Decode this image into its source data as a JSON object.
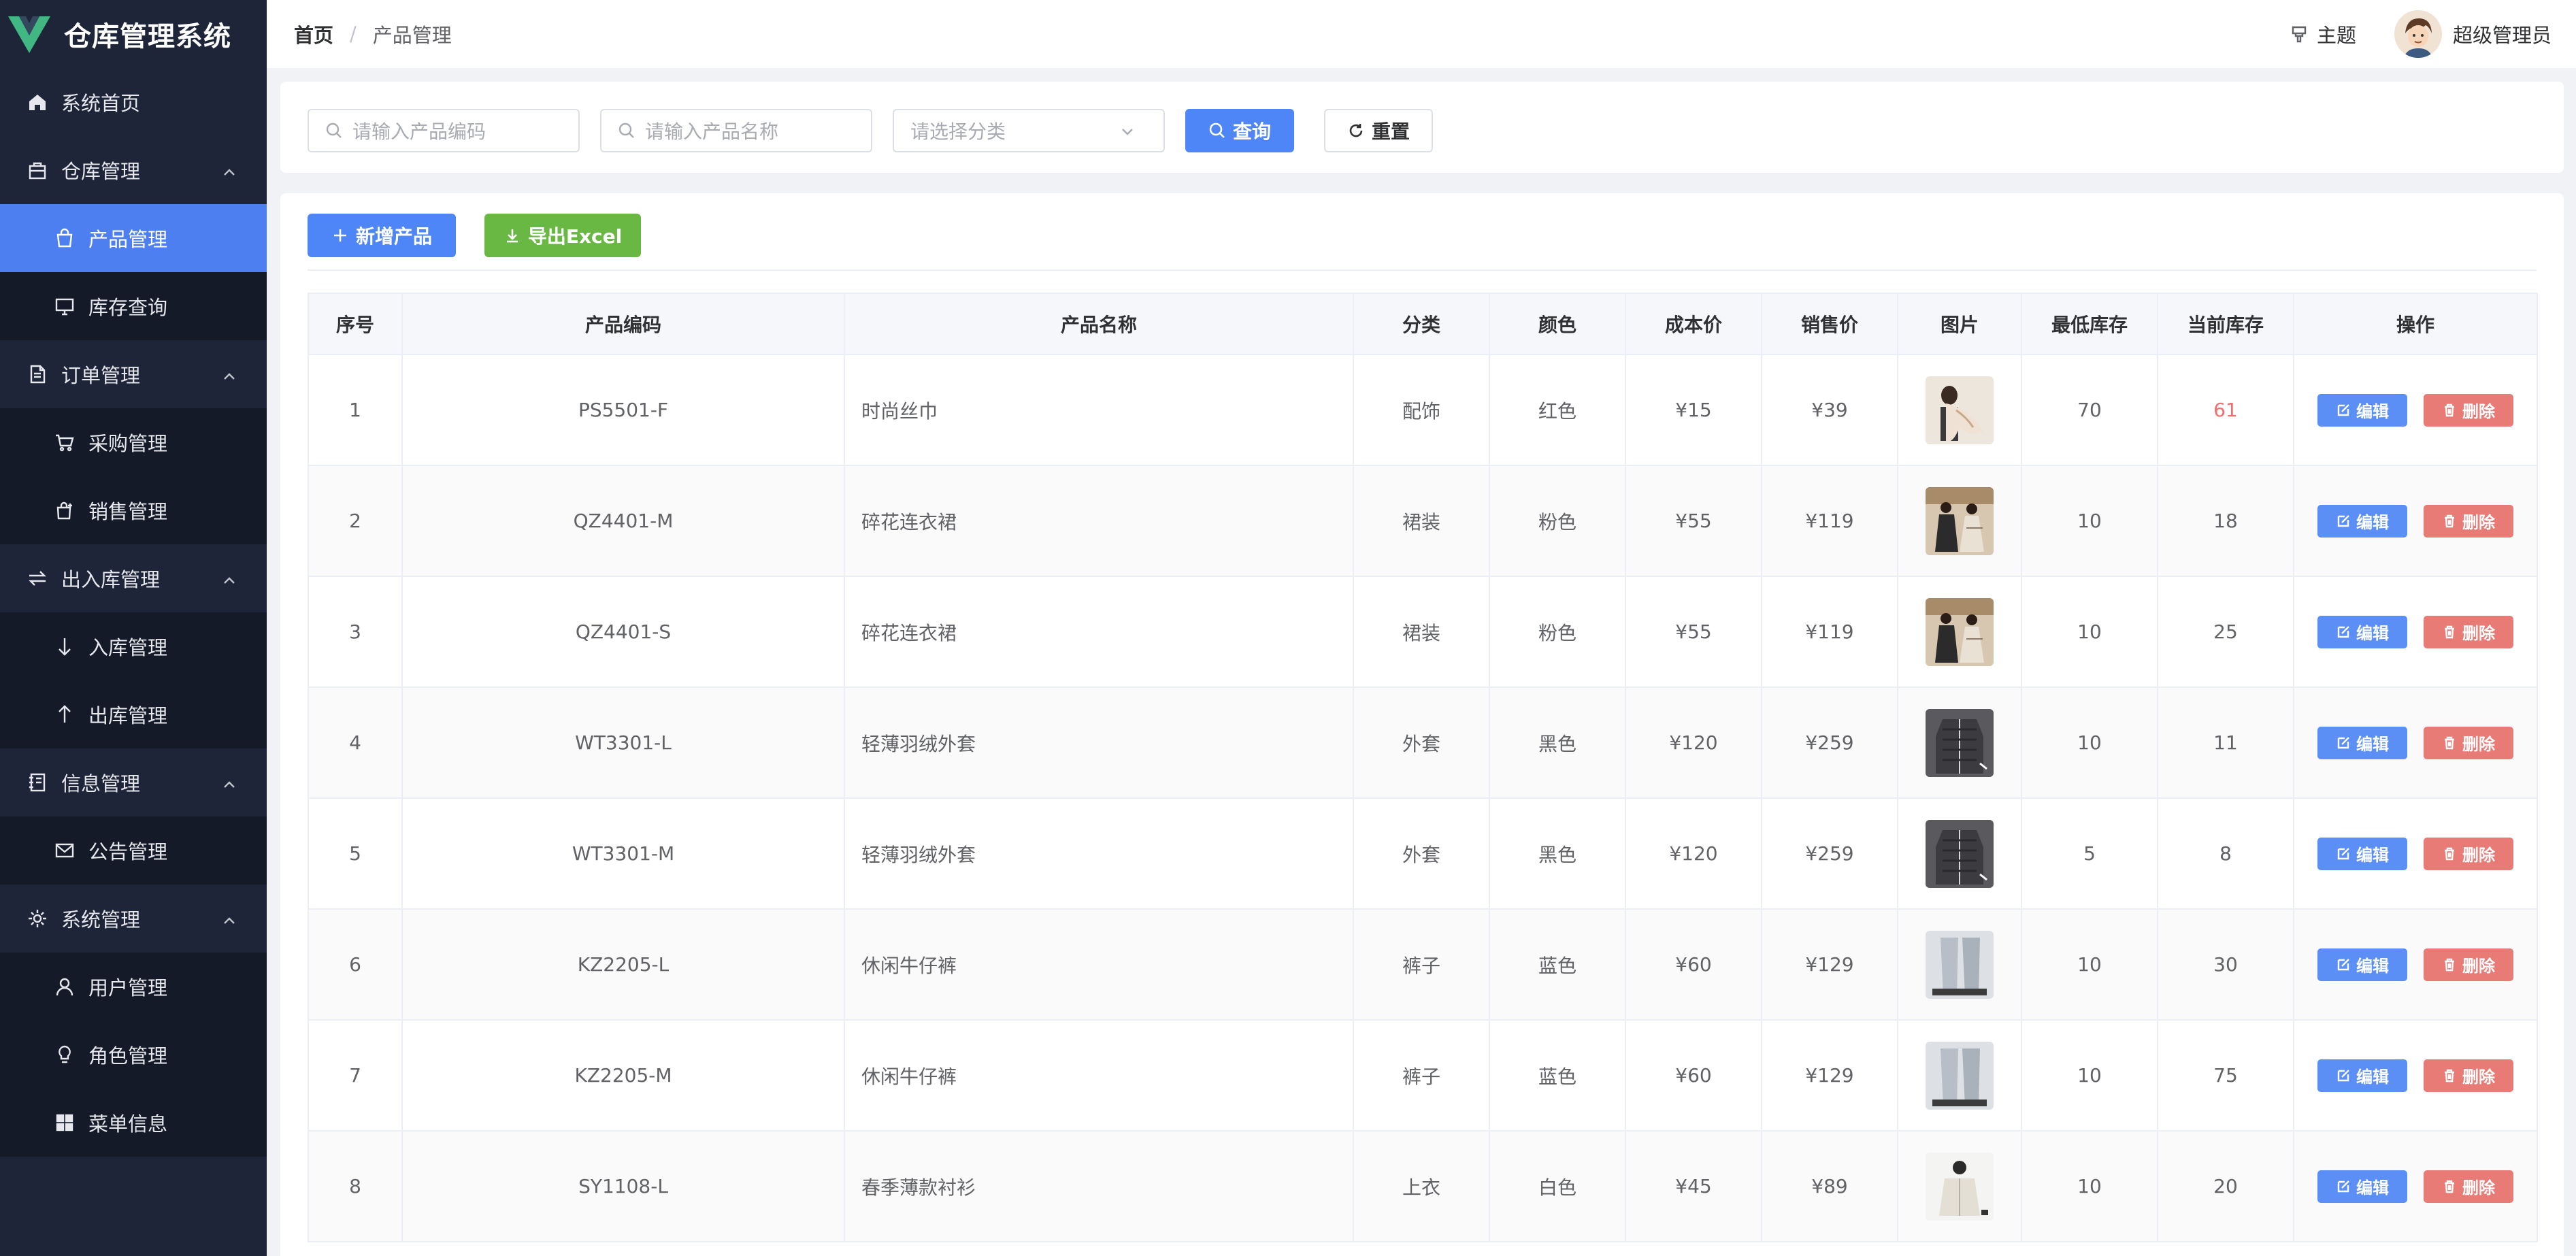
{
  "app": {
    "title": "仓库管理系统",
    "logo_color": "#41b883"
  },
  "sidebar": {
    "items": [
      {
        "label": "系统首页",
        "icon": "home-icon",
        "level": 1
      },
      {
        "label": "仓库管理",
        "icon": "warehouse-icon",
        "level": 1,
        "expanded": true
      },
      {
        "label": "产品管理",
        "icon": "bag-icon",
        "level": 2,
        "active": true
      },
      {
        "label": "库存查询",
        "icon": "monitor-icon",
        "level": 2
      },
      {
        "label": "订单管理",
        "icon": "document-icon",
        "level": 1,
        "expanded": true
      },
      {
        "label": "采购管理",
        "icon": "cart-icon",
        "level": 2
      },
      {
        "label": "销售管理",
        "icon": "sale-bag-icon",
        "level": 2
      },
      {
        "label": "出入库管理",
        "icon": "transfer-icon",
        "level": 1,
        "expanded": true
      },
      {
        "label": "入库管理",
        "icon": "arrow-down-icon",
        "level": 2
      },
      {
        "label": "出库管理",
        "icon": "arrow-up-icon",
        "level": 2
      },
      {
        "label": "信息管理",
        "icon": "notebook-icon",
        "level": 1,
        "expanded": true
      },
      {
        "label": "公告管理",
        "icon": "mail-icon",
        "level": 2
      },
      {
        "label": "系统管理",
        "icon": "gear-icon",
        "level": 1,
        "expanded": true
      },
      {
        "label": "用户管理",
        "icon": "user-icon",
        "level": 2
      },
      {
        "label": "角色管理",
        "icon": "bulb-icon",
        "level": 2
      },
      {
        "label": "菜单信息",
        "icon": "grid-icon",
        "level": 2
      }
    ]
  },
  "header": {
    "breadcrumb_home": "首页",
    "breadcrumb_sep": "/",
    "breadcrumb_current": "产品管理",
    "theme_label": "主题",
    "user_name": "超级管理员"
  },
  "search": {
    "code_placeholder": "请输入产品编码",
    "name_placeholder": "请输入产品名称",
    "category_placeholder": "请选择分类",
    "query_label": "查询",
    "reset_label": "重置"
  },
  "toolbar": {
    "add_label": "新增产品",
    "export_label": "导出Excel"
  },
  "table": {
    "headers": [
      "序号",
      "产品编码",
      "产品名称",
      "分类",
      "颜色",
      "成本价",
      "销售价",
      "图片",
      "最低库存",
      "当前库存",
      "操作"
    ],
    "edit_label": "编辑",
    "delete_label": "删除",
    "rows": [
      {
        "index": "1",
        "code": "PS5501-F",
        "name": "时尚丝巾",
        "category": "配饰",
        "color": "红色",
        "cost": "¥15",
        "price": "¥39",
        "min_stock": "70",
        "stock": "61",
        "low": true,
        "image": "scarf"
      },
      {
        "index": "2",
        "code": "QZ4401-M",
        "name": "碎花连衣裙",
        "category": "裙装",
        "color": "粉色",
        "cost": "¥55",
        "price": "¥119",
        "min_stock": "10",
        "stock": "18",
        "low": false,
        "image": "dress"
      },
      {
        "index": "3",
        "code": "QZ4401-S",
        "name": "碎花连衣裙",
        "category": "裙装",
        "color": "粉色",
        "cost": "¥55",
        "price": "¥119",
        "min_stock": "10",
        "stock": "25",
        "low": false,
        "image": "dress"
      },
      {
        "index": "4",
        "code": "WT3301-L",
        "name": "轻薄羽绒外套",
        "category": "外套",
        "color": "黑色",
        "cost": "¥120",
        "price": "¥259",
        "min_stock": "10",
        "stock": "11",
        "low": false,
        "image": "jacket"
      },
      {
        "index": "5",
        "code": "WT3301-M",
        "name": "轻薄羽绒外套",
        "category": "外套",
        "color": "黑色",
        "cost": "¥120",
        "price": "¥259",
        "min_stock": "5",
        "stock": "8",
        "low": false,
        "image": "jacket"
      },
      {
        "index": "6",
        "code": "KZ2205-L",
        "name": "休闲牛仔裤",
        "category": "裤子",
        "color": "蓝色",
        "cost": "¥60",
        "price": "¥129",
        "min_stock": "10",
        "stock": "30",
        "low": false,
        "image": "jeans"
      },
      {
        "index": "7",
        "code": "KZ2205-M",
        "name": "休闲牛仔裤",
        "category": "裤子",
        "color": "蓝色",
        "cost": "¥60",
        "price": "¥129",
        "min_stock": "10",
        "stock": "75",
        "low": false,
        "image": "jeans"
      },
      {
        "index": "8",
        "code": "SY1108-L",
        "name": "春季薄款衬衫",
        "category": "上衣",
        "color": "白色",
        "cost": "¥45",
        "price": "¥89",
        "min_stock": "10",
        "stock": "20",
        "low": false,
        "image": "shirt"
      }
    ]
  },
  "colors": {
    "sidebar_bg": "#1e2538",
    "active": "#4e7ff0",
    "primary": "#4e86f7",
    "success": "#6ab844",
    "danger": "#e87b76",
    "warning_text": "#f56c6c"
  }
}
